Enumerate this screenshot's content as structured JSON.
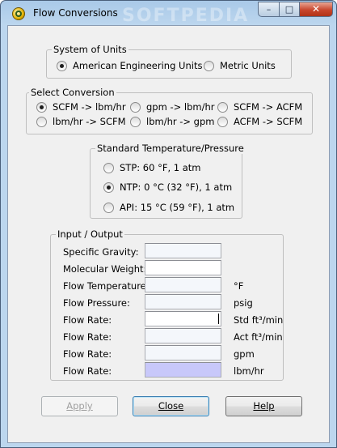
{
  "window": {
    "title": "Flow Conversions",
    "watermark": "SOFTPEDIA",
    "min": "–",
    "max": "□",
    "close": "✕"
  },
  "units": {
    "legend": "System of Units",
    "options": [
      {
        "label": "American Engineering Units",
        "checked": true
      },
      {
        "label": "Metric Units",
        "checked": false
      }
    ]
  },
  "conversion": {
    "legend": "Select Conversion",
    "options": [
      {
        "label": "SCFM -> lbm/hr",
        "checked": true
      },
      {
        "label": "gpm -> lbm/hr",
        "checked": false
      },
      {
        "label": "SCFM -> ACFM",
        "checked": false
      },
      {
        "label": "lbm/hr -> SCFM",
        "checked": false
      },
      {
        "label": "lbm/hr -> gpm",
        "checked": false
      },
      {
        "label": "ACFM -> SCFM",
        "checked": false
      }
    ]
  },
  "stp": {
    "legend": "Standard Temperature/Pressure",
    "options": [
      {
        "label": "STP:  60 °F, 1 atm",
        "checked": false
      },
      {
        "label": "NTP:  0 °C (32 °F), 1 atm",
        "checked": true
      },
      {
        "label": "API:  15 °C (59 °F), 1 atm",
        "checked": false
      }
    ]
  },
  "io": {
    "legend": "Input / Output",
    "rows": [
      {
        "label": "Specific Gravity:",
        "unit": ""
      },
      {
        "label": "Molecular Weight:",
        "unit": ""
      },
      {
        "label": "Flow Temperature:",
        "unit": "°F"
      },
      {
        "label": "Flow Pressure:",
        "unit": "psig"
      },
      {
        "label": "Flow Rate:",
        "unit": "Std ft³/min"
      },
      {
        "label": "Flow Rate:",
        "unit": "Act ft³/min"
      },
      {
        "label": "Flow Rate:",
        "unit": "gpm"
      },
      {
        "label": "Flow Rate:",
        "unit": "lbm/hr"
      }
    ]
  },
  "buttons": {
    "apply": "Apply",
    "close": "Close",
    "help": "Help"
  }
}
